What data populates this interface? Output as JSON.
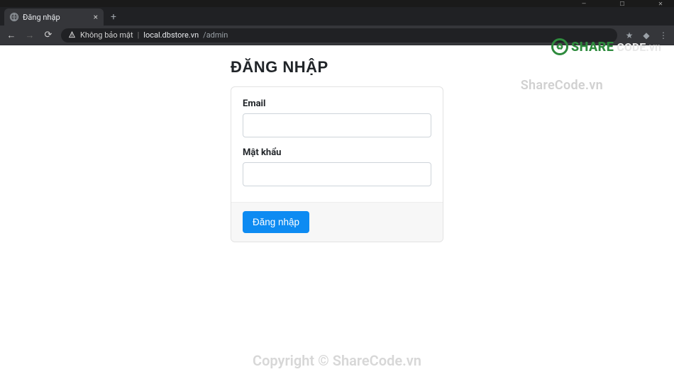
{
  "browser": {
    "tab": {
      "title": "Đăng nhập",
      "favicon": "globe-icon"
    },
    "navigation": {
      "back": true,
      "forward": false,
      "reload": true
    },
    "address": {
      "security_label": "Không bảo mật",
      "host": "local.dbstore.vn",
      "path": "/admin"
    }
  },
  "page": {
    "title": "ĐĂNG NHẬP",
    "form": {
      "email_label": "Email",
      "email_value": "",
      "password_label": "Mật khẩu",
      "password_value": "",
      "submit_label": "Đăng nhập"
    }
  },
  "watermarks": {
    "top_right_text": "ShareCode.vn",
    "logo_text_green": "SHARE",
    "logo_text_light": "CODE.vn",
    "bottom_text": "Copyright © ShareCode.vn"
  }
}
